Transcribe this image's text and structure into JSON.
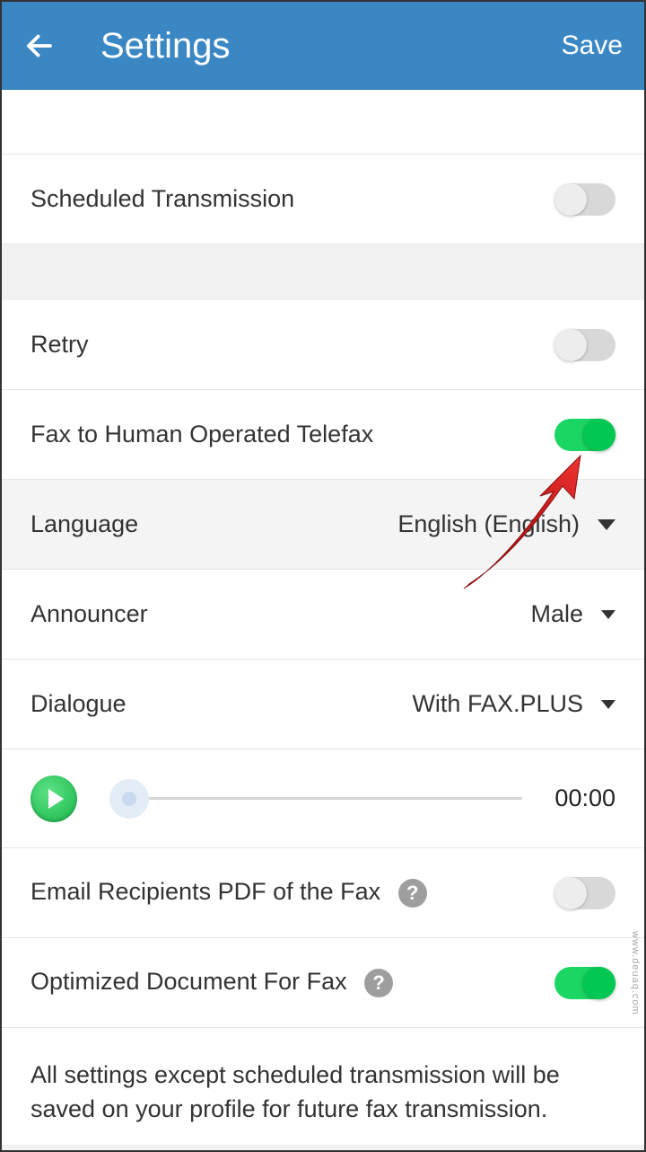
{
  "header": {
    "title": "Settings",
    "save": "Save"
  },
  "rows": {
    "scheduled": "Scheduled Transmission",
    "retry": "Retry",
    "fax_human": "Fax to Human Operated Telefax",
    "language_label": "Language",
    "language_value": "English (English)",
    "announcer_label": "Announcer",
    "announcer_value": "Male",
    "dialogue_label": "Dialogue",
    "dialogue_value": "With FAX.PLUS",
    "time": "00:00",
    "email_pdf": "Email Recipients PDF of the Fax",
    "optimize": "Optimized Document For Fax"
  },
  "footer": "All settings except scheduled transmission will be saved on your profile for future fax transmission.",
  "watermark": "www.deuaq.com"
}
